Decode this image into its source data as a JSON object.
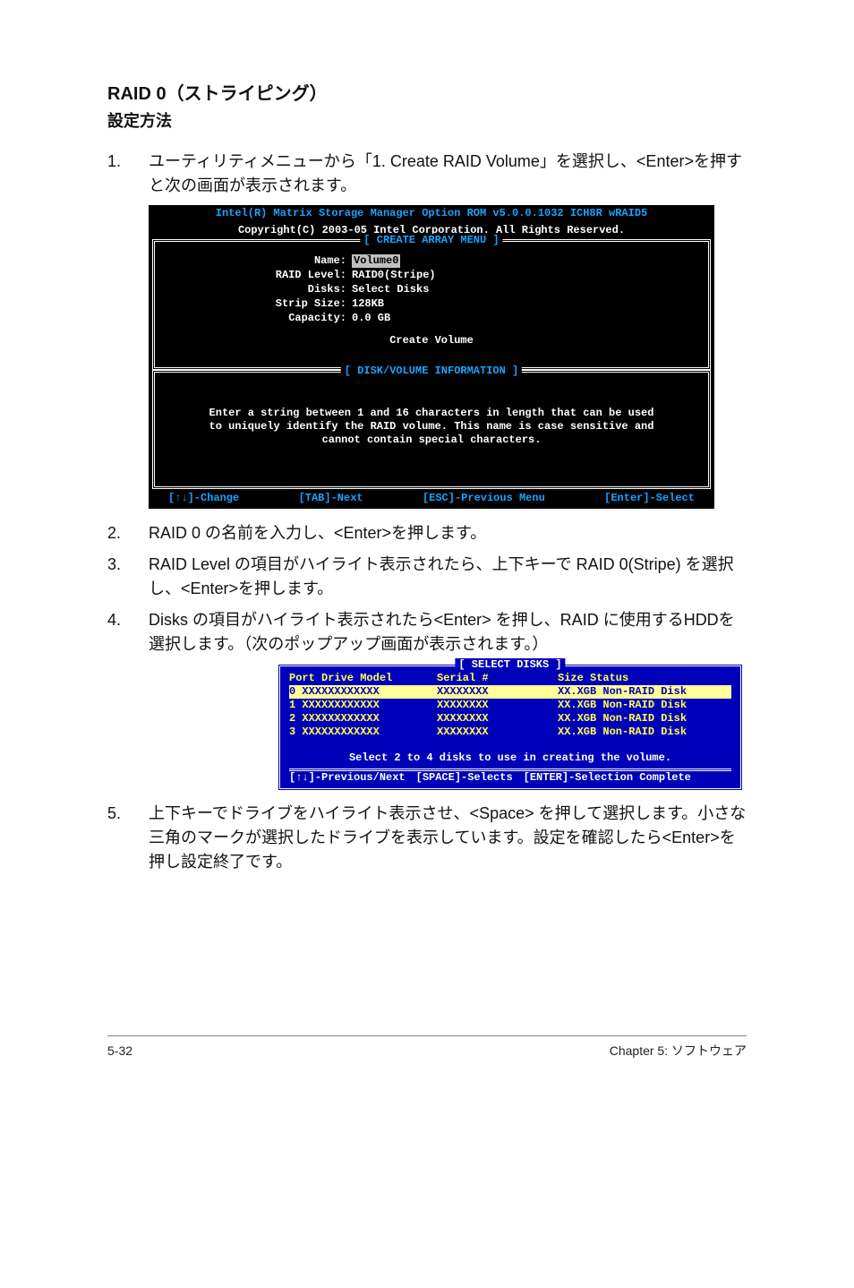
{
  "section": {
    "title": "RAID 0（ストライピング）",
    "subtitle": "設定方法"
  },
  "steps": {
    "s1": {
      "num": "1.",
      "text": "ユーティリティメニューから「1. Create RAID Volume」を選択し、<Enter>を押すと次の画面が表示されます。"
    },
    "s2": {
      "num": "2.",
      "text": "RAID 0 の名前を入力し、<Enter>を押します。"
    },
    "s3": {
      "num": "3.",
      "text": "RAID Level の項目がハイライト表示されたら、上下キーで RAID 0(Stripe) を選択し、<Enter>を押します。"
    },
    "s4": {
      "num": "4.",
      "text": "Disks の項目がハイライト表示されたら<Enter> を押し、RAID に使用するHDDを選択します。（次のポップアップ画面が表示されます。）"
    },
    "s5": {
      "num": "5.",
      "text": "上下キーでドライブをハイライト表示させ、<Space> を押して選択します。小さな三角のマークが選択したドライブを表示しています。設定を確認したら<Enter>を押し設定終了です。"
    }
  },
  "term1": {
    "banner1": "Intel(R) Matrix Storage Manager Option ROM v5.0.0.1032 ICH8R wRAID5",
    "banner2": "Copyright(C) 2003-05 Intel Corporation. All Rights Reserved.",
    "boxTitle": "[ CREATE ARRAY MENU ]",
    "fields": {
      "name": {
        "label": "Name:",
        "value": "Volume0"
      },
      "level": {
        "label": "RAID Level:",
        "value": "RAID0(Stripe)"
      },
      "disks": {
        "label": "Disks:",
        "value": "Select Disks"
      },
      "strip": {
        "label": "Strip Size:",
        "value": "128KB"
      },
      "cap": {
        "label": "Capacity:",
        "value": "0.0   GB"
      }
    },
    "create": "Create Volume",
    "infoTitle": "[ DISK/VOLUME INFORMATION ]",
    "infoMsg1": "Enter a string between 1 and 16 characters in length that can be used",
    "infoMsg2": "to uniquely identify the RAID volume. This name is case sensitive and",
    "infoMsg3": "cannot contain special characters.",
    "bar": {
      "a": "[↑↓]-Change",
      "b": "[TAB]-Next",
      "c": "[ESC]-Previous Menu",
      "d": "[Enter]-Select"
    }
  },
  "sel": {
    "title": "[ SELECT DISKS ]",
    "header": {
      "c1": "Port Drive Model",
      "c2": "Serial #",
      "c3": "Size Status"
    },
    "rows": [
      {
        "c1": "0 XXXXXXXXXXXX",
        "c2": "XXXXXXXX",
        "c3": "XX.XGB Non-RAID Disk",
        "hi": true
      },
      {
        "c1": "1 XXXXXXXXXXXX",
        "c2": "XXXXXXXX",
        "c3": "XX.XGB Non-RAID Disk",
        "hi": false
      },
      {
        "c1": "2 XXXXXXXXXXXX",
        "c2": "XXXXXXXX",
        "c3": "XX.XGB Non-RAID Disk",
        "hi": false
      },
      {
        "c1": "3 XXXXXXXXXXXX",
        "c2": "XXXXXXXX",
        "c3": "XX.XGB Non-RAID Disk",
        "hi": false
      }
    ],
    "msg": "Select 2 to 4 disks to use in creating the volume.",
    "bottom": {
      "a": "[↑↓]-Previous/Next",
      "b": "[SPACE]-Selects",
      "c": "[ENTER]-Selection Complete"
    }
  },
  "footer": {
    "left": "5-32",
    "right": "Chapter 5: ソフトウェア"
  }
}
